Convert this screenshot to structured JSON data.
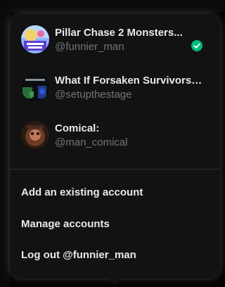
{
  "accounts": [
    {
      "name": "Pillar Chase 2 Monsters...",
      "handle": "@funnier_man",
      "avatar_icon": "avatar-pillar-chase",
      "selected": true
    },
    {
      "name": "What If Forsaken Survivors h...",
      "handle": "@setupthestage",
      "avatar_icon": "avatar-forsaken",
      "selected": false
    },
    {
      "name": "Comical:",
      "handle": "@man_comical",
      "avatar_icon": "avatar-comical",
      "selected": false
    }
  ],
  "actions": {
    "add_existing": "Add an existing account",
    "manage": "Manage accounts",
    "logout": "Log out @funnier_man"
  },
  "colors": {
    "menu_bg": "#121212",
    "primary_text": "#e7e9ea",
    "secondary_text": "#71767b",
    "check_green": "#00ba7c",
    "divider": "#2f3336"
  },
  "icons": {
    "selected_indicator": "check-circle-icon"
  }
}
